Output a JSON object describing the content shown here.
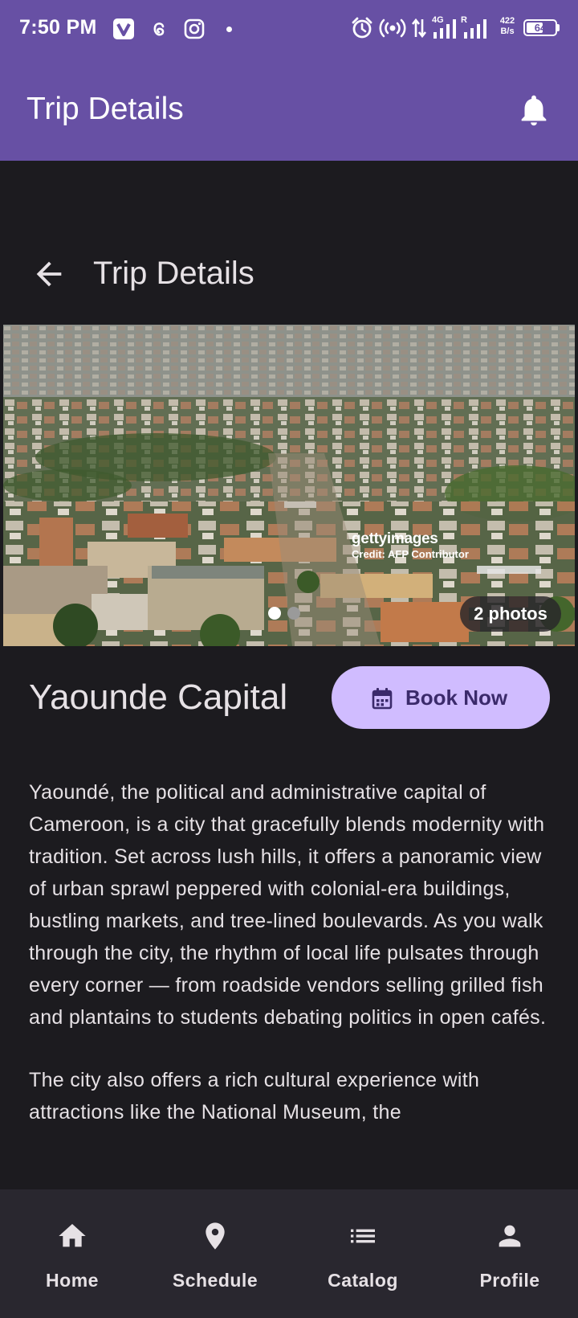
{
  "status_bar": {
    "time": "7:50 PM",
    "net_speed_value": "422",
    "net_speed_unit": "B/s",
    "battery_level": "64",
    "battery_fraction": 0.64,
    "network_label": "4G",
    "roaming_label": "R",
    "icons": [
      "v-app-icon",
      "threads-icon",
      "instagram-icon",
      "notification-dot",
      "alarm-icon",
      "hotspot-icon",
      "data-arrows-icon",
      "signal-icon",
      "signal-icon",
      "battery-icon"
    ]
  },
  "app_bar": {
    "title": "Trip Details",
    "action_icon": "bell-icon"
  },
  "page_header": {
    "back_icon": "arrow-back-icon",
    "title": "Trip Details"
  },
  "gallery": {
    "watermark_brand": "gettyimages",
    "watermark_credit": "Credit: AFP Contributor",
    "photo_count_label": "2 photos",
    "total_photos": 2,
    "current_index": 0,
    "active_dot_color": "#ffffff",
    "inactive_dot_color": "#9a9a9a"
  },
  "trip": {
    "name": "Yaounde Capital",
    "book_button_label": "Book Now",
    "book_button_icon": "calendar-icon",
    "description": [
      "Yaoundé, the political and administrative capital of Cameroon, is a city that gracefully blends modernity with tradition. Set across lush hills, it offers a panoramic view of urban sprawl peppered with colonial-era buildings, bustling markets, and tree-lined boulevards. As you walk through the city, the rhythm of local life pulsates through every corner — from roadside vendors selling grilled fish and plantains to students debating politics in open cafés.",
      "The city also offers a rich cultural experience with attractions like the National Museum, the"
    ]
  },
  "bottom_nav": {
    "items": [
      {
        "label": "Home",
        "icon": "home-icon"
      },
      {
        "label": "Schedule",
        "icon": "location-pin-icon"
      },
      {
        "label": "Catalog",
        "icon": "list-icon"
      },
      {
        "label": "Profile",
        "icon": "person-icon"
      }
    ]
  },
  "colors": {
    "primary": "#6750a4",
    "background": "#1c1b1f",
    "button": "#d0bcff",
    "nav_background": "#29272f",
    "on_surface": "#e6e1e5"
  }
}
